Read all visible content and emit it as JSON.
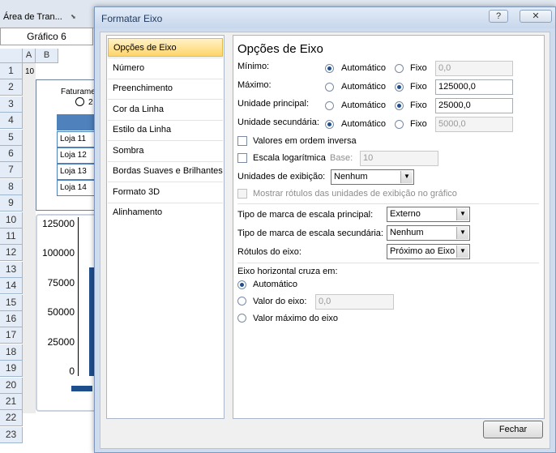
{
  "excel": {
    "ribbon_label": "Área de Tran...",
    "name_box": "Gráfico 6",
    "columns": [
      "A",
      "B"
    ],
    "rows": [
      "1",
      "2",
      "3",
      "4",
      "5",
      "6",
      "7",
      "8",
      "9",
      "10",
      "11",
      "12",
      "13",
      "14",
      "15",
      "16",
      "17",
      "18",
      "19",
      "20",
      "21",
      "22",
      "23"
    ],
    "cell_a1": "10",
    "chart1_title": "Faturame",
    "chart1_option": "2",
    "table_rows": [
      "Loja 11",
      "Loja 12",
      "Loja 13",
      "Loja 14"
    ],
    "axis_labels": [
      "125000",
      "100000",
      "75000",
      "50000",
      "25000",
      "0"
    ]
  },
  "dialog": {
    "title": "Formatar Eixo",
    "help_label": "?",
    "close_label": "✕",
    "nav_items": [
      "Opções de Eixo",
      "Número",
      "Preenchimento",
      "Cor da Linha",
      "Estilo da Linha",
      "Sombra",
      "Bordas Suaves e Brilhantes",
      "Formato 3D",
      "Alinhamento"
    ],
    "selected_nav": "Opções de Eixo",
    "panel_title": "Opções de Eixo",
    "auto_label": "Automático",
    "fixed_label": "Fixo",
    "rows": [
      {
        "label": "Mínimo:",
        "mode": "auto",
        "value": "0,0",
        "enabled": false
      },
      {
        "label": "Máximo:",
        "mode": "fixed",
        "value": "125000,0",
        "enabled": true
      },
      {
        "label": "Unidade principal:",
        "mode": "fixed",
        "value": "25000,0",
        "enabled": true
      },
      {
        "label": "Unidade secundária:",
        "mode": "auto",
        "value": "5000,0",
        "enabled": false
      }
    ],
    "reverse_order_label": "Valores em ordem inversa",
    "reverse_order_checked": false,
    "log_scale_label": "Escala logarítmica",
    "log_scale_checked": false,
    "base_label": "Base:",
    "base_value": "10",
    "display_units_label": "Unidades de exibição:",
    "display_units_value": "Nenhum",
    "show_units_label": "Mostrar rótulos das unidades de exibição no gráfico",
    "major_tick_label": "Tipo de marca de escala principal:",
    "major_tick_value": "Externo",
    "minor_tick_label": "Tipo de marca de escala secundária:",
    "minor_tick_value": "Nenhum",
    "axis_labels_label": "Rótulos do eixo:",
    "axis_labels_value": "Próximo ao Eixo",
    "crosses_title": "Eixo horizontal cruza em:",
    "crosses_auto": "Automático",
    "crosses_value_label": "Valor do eixo:",
    "crosses_value": "0,0",
    "crosses_max": "Valor máximo do eixo",
    "crosses_selected": "auto",
    "close_button": "Fechar"
  }
}
